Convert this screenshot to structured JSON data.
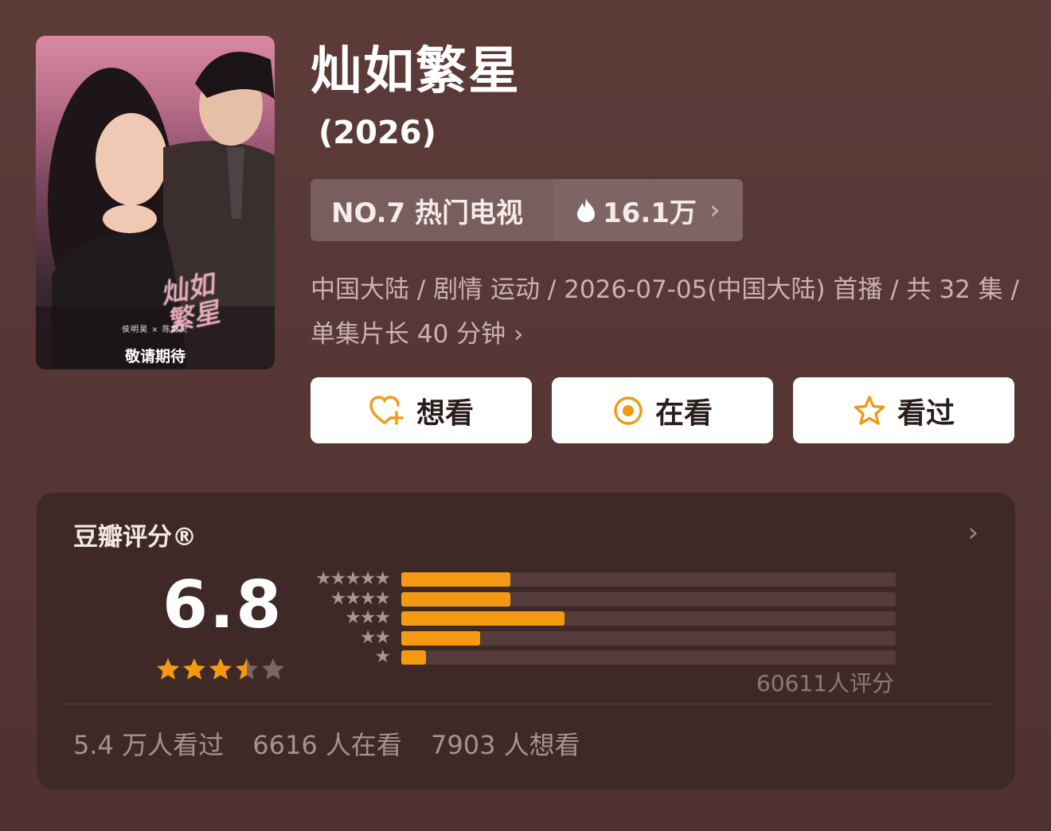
{
  "show": {
    "title": "灿如繁星",
    "year": "(2026)"
  },
  "poster": {
    "calligraphy": "灿如繁星",
    "cast_line": "侯明昊 × 陈都灵",
    "tagline": "敬请期待"
  },
  "ranking": {
    "label": "NO.7 热门电视",
    "heat": "16.1万"
  },
  "meta": {
    "info": "中国大陆 / 剧情 运动 / 2026-07-05(中国大陆) 首播 / 共 32 集 / 单集片长 40 分钟"
  },
  "actions": {
    "want": "想看",
    "watching": "在看",
    "watched": "看过"
  },
  "rating": {
    "heading": "豆瓣评分®",
    "score": "6.8",
    "stars_value": 3.5,
    "distribution": [
      {
        "stars": "★★★★★",
        "fraction": 0.22
      },
      {
        "stars": "★★★★",
        "fraction": 0.22
      },
      {
        "stars": "★★★",
        "fraction": 0.33
      },
      {
        "stars": "★★",
        "fraction": 0.16
      },
      {
        "stars": "★",
        "fraction": 0.05
      }
    ],
    "count": "60611人评分"
  },
  "stats": {
    "watched": "5.4 万人看过",
    "watching": "6616 人在看",
    "want": "7903 人想看"
  },
  "colors": {
    "accent": "#f39a12",
    "background": "#573836",
    "card": "#3f2927"
  }
}
